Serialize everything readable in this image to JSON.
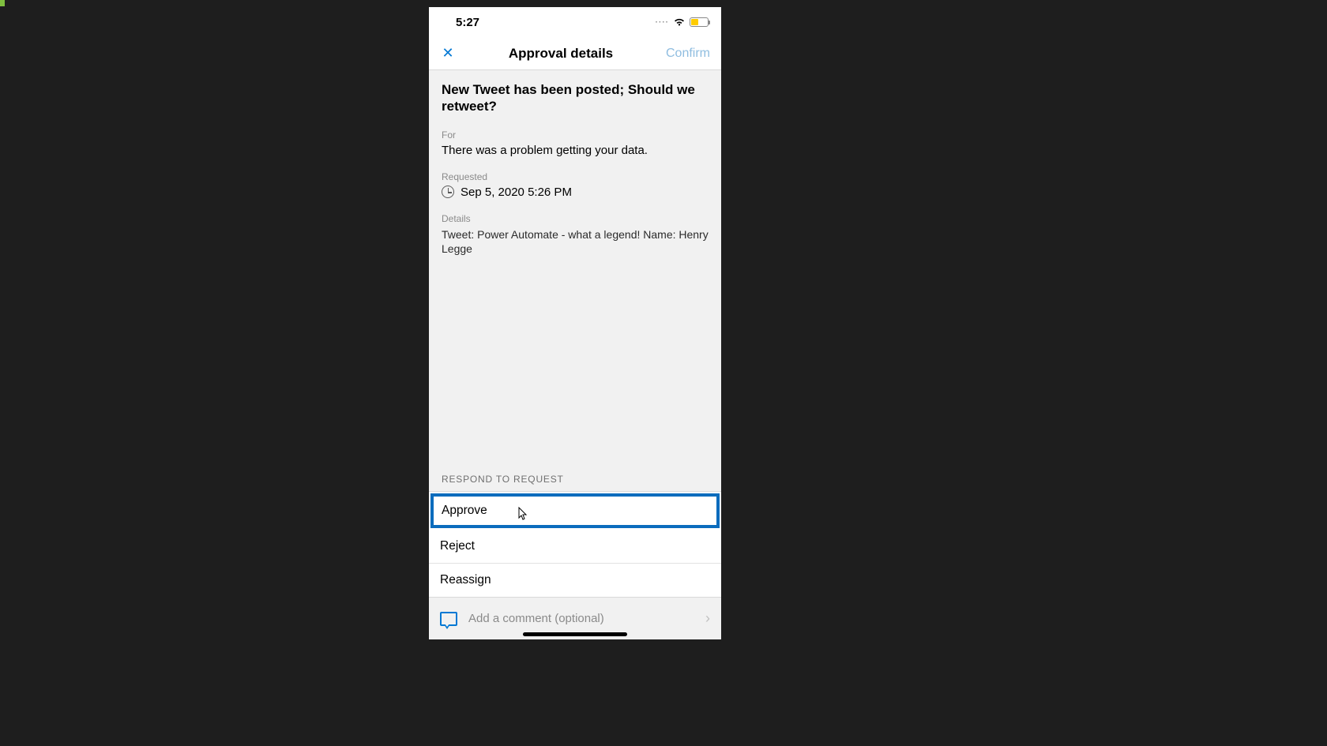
{
  "status": {
    "time": "5:27",
    "cell": "····"
  },
  "nav": {
    "title": "Approval details",
    "confirm": "Confirm"
  },
  "approval": {
    "title": "New Tweet has been posted; Should we retweet?",
    "for_label": "For",
    "for_value": "There was a problem getting your data.",
    "requested_label": "Requested",
    "requested_value": "Sep 5, 2020 5:26 PM",
    "details_label": "Details",
    "details_value": "Tweet: Power Automate - what a legend! Name: Henry Legge"
  },
  "respond": {
    "label": "RESPOND TO REQUEST",
    "options": {
      "approve": "Approve",
      "reject": "Reject",
      "reassign": "Reassign"
    },
    "selected": "approve"
  },
  "comment": {
    "placeholder": "Add a comment (optional)"
  }
}
